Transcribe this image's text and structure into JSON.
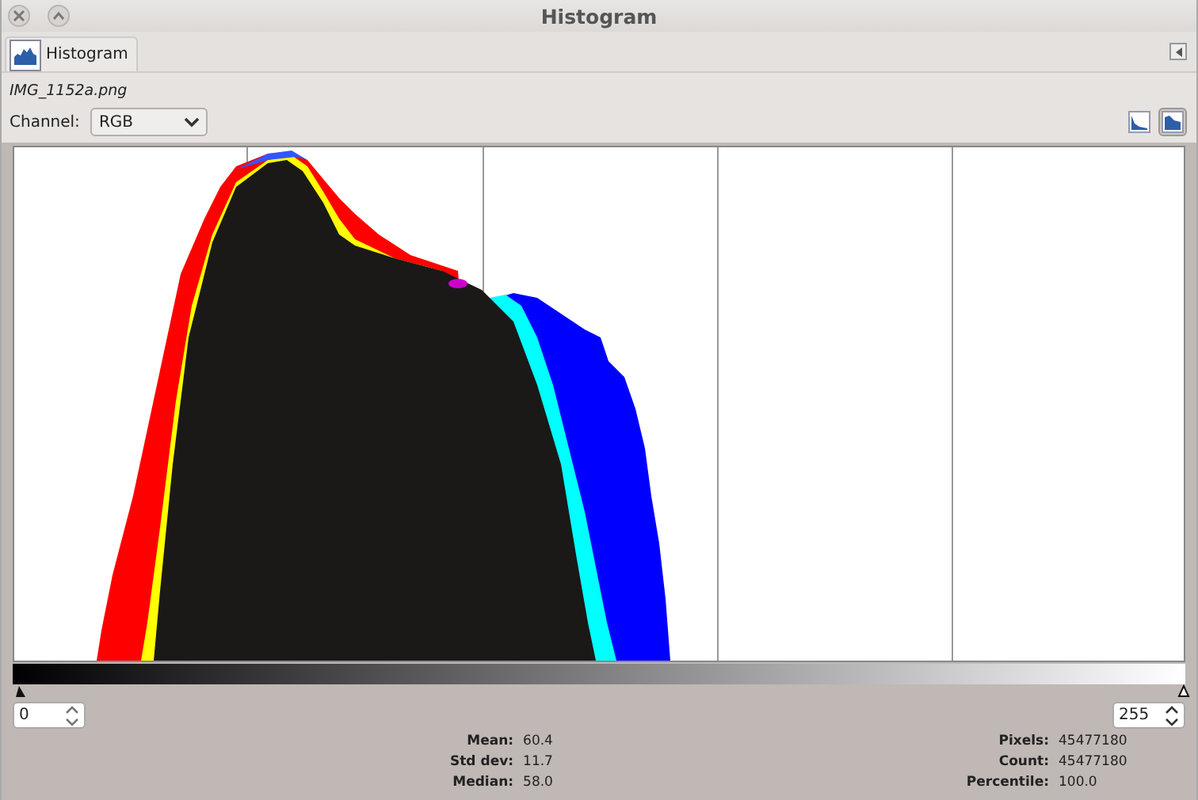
{
  "window": {
    "title": "Histogram"
  },
  "tabs": [
    {
      "label": "Histogram",
      "selected": true
    }
  ],
  "image_name": "IMG_1152a.png",
  "channel": {
    "label": "Channel:",
    "value": "RGB"
  },
  "view_buttons": [
    {
      "kind": "linear",
      "selected": false
    },
    {
      "kind": "log",
      "selected": true
    }
  ],
  "range": {
    "low": "0",
    "high": "255"
  },
  "stats_left": [
    {
      "label": "Mean:",
      "value": "60.4"
    },
    {
      "label": "Std dev:",
      "value": "11.7"
    },
    {
      "label": "Median:",
      "value": "58.0"
    }
  ],
  "stats_right": [
    {
      "label": "Pixels:",
      "value": "45477180"
    },
    {
      "label": "Count:",
      "value": "45477180"
    },
    {
      "label": "Percentile:",
      "value": "100.0"
    }
  ]
}
